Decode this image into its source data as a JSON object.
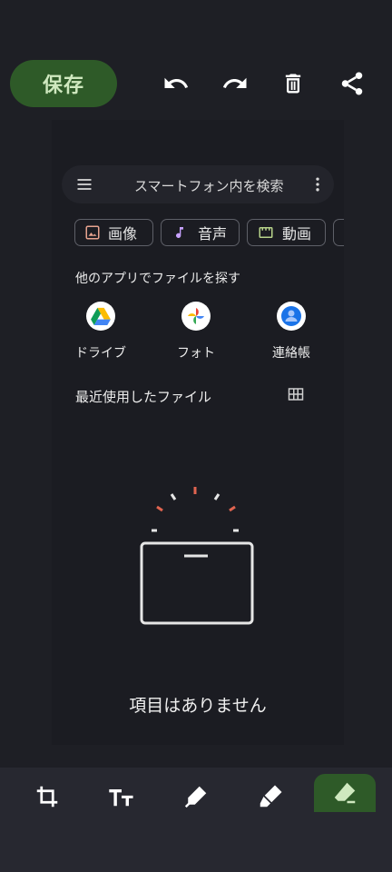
{
  "header": {
    "save_label": "保存",
    "icons": [
      "undo-icon",
      "redo-icon",
      "delete-icon",
      "share-icon"
    ]
  },
  "picker": {
    "search_placeholder": "スマートフォン内を検索",
    "chips": [
      {
        "label": "画像",
        "icon": "image-icon",
        "color": "#e7a38f"
      },
      {
        "label": "音声",
        "icon": "music-note-icon",
        "color": "#c7a2ff"
      },
      {
        "label": "動画",
        "icon": "movie-icon",
        "color": "#b7d38a"
      }
    ],
    "other_apps_title": "他のアプリでファイルを探す",
    "apps": [
      {
        "label": "ドライブ",
        "icon": "google-drive-icon"
      },
      {
        "label": "フォト",
        "icon": "google-photos-icon"
      },
      {
        "label": "連絡帳",
        "icon": "contacts-icon"
      }
    ],
    "recent_title": "最近使用したファイル",
    "empty_message": "項目はありません"
  },
  "toolbar": {
    "tools": [
      "crop-icon",
      "text-icon",
      "pen-icon",
      "highlighter-icon",
      "eraser-icon"
    ],
    "active_tool": "eraser-icon"
  },
  "colors": {
    "accent_green": "#2e5a28",
    "save_text": "#cfe8bf"
  }
}
